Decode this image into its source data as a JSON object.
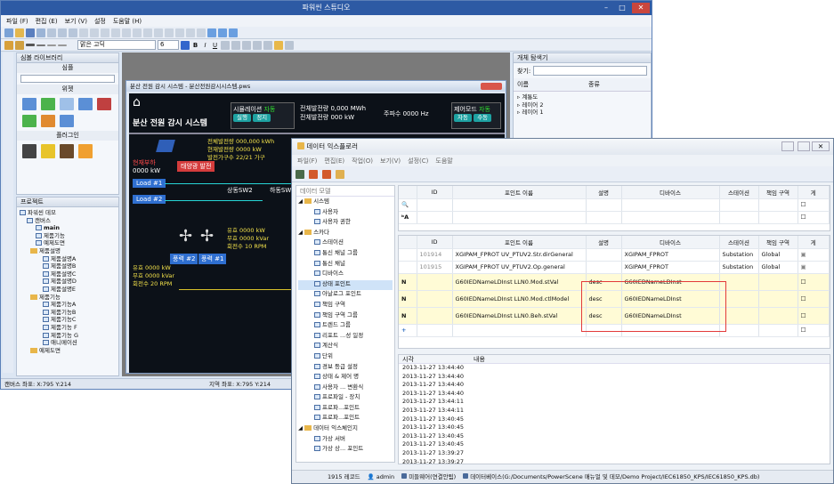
{
  "studio": {
    "title": "파워씬 스튜디오",
    "menu": [
      "파일 (F)",
      "편집 (E)",
      "보기 (V)",
      "설정",
      "도움말 (H)"
    ],
    "font_name": "맑은 고딕",
    "font_size": "6",
    "status_left": "캔버스 좌표: X:795 Y:214",
    "status_mid": "지역 좌표: X:795 Y:214"
  },
  "symbol_lib": {
    "title": "심볼 라이브러리",
    "sec1": "심플",
    "sec2": "위젯",
    "sec3": "플러그인"
  },
  "project": {
    "title": "프로젝트",
    "items": [
      "파워씬 데모",
      "캔버스",
      "main",
      "제품기능",
      "예제도면",
      "제품설명",
      "제품설명A",
      "제품설명B",
      "제품설명C",
      "제품설명D",
      "제품설명E",
      "제품기능",
      "제품기능A",
      "제품기능B",
      "제품기능C",
      "제품기능 F",
      "제품기능 G",
      "애니메이션",
      "예제도면"
    ]
  },
  "obj_explorer": {
    "title": "개체 탐색기",
    "search": "찾기:",
    "col_name": "이름",
    "col_type": "종류",
    "items": [
      "계통도",
      "레이어 2",
      "레이어 1"
    ]
  },
  "doc": {
    "title": "분산 전원 감시 시스템 - 분산전원감시시스템.pws",
    "heading": "분산 전원 감시 시스템",
    "sim_label": "시뮬레이션",
    "sim_state": "자동",
    "btn_run": "실행",
    "btn_stop": "정지",
    "total_gen": "전체발전량",
    "total_gen_val": "0,000 MWh",
    "total_pow": "전체발전량",
    "total_pow_val": "000 kW",
    "freq_label": "주파수",
    "freq_val": "0000 Hz",
    "ctrl_mode": "제어모드",
    "ctrl_state": "자동",
    "btn_auto": "자동",
    "btn_manual": "수동",
    "solar_lines": [
      "전체발전량 000,000 kWh",
      "현재발전량 0000 kW",
      "발전가구수 22/21 가구"
    ],
    "load_now": "현재부하",
    "load_val": "0000 kW",
    "solar_btn": "태양광 발전",
    "load1": "Load #1",
    "load2": "Load #2",
    "sw2": "상동SW2",
    "sw1": "하동SW1",
    "wind_lines": [
      "유효 0000 kW",
      "무효 0000 kVar",
      "회전수 10 RPM"
    ],
    "wind_btn1": "풍력 #2",
    "wind_btn2": "풍력 #1",
    "wind2_lines": [
      "유효 0000 kW",
      "무효 0000 kVar",
      "회전수 20 RPM"
    ]
  },
  "explorer": {
    "title": "데이터 익스플로러",
    "menu": [
      "파일(F)",
      "편집(E)",
      "작업(O)",
      "보기(V)",
      "설정(C)",
      "도움말"
    ],
    "model_hdr": "데이터 모델",
    "tree": [
      "시스템",
      "사용자",
      "사용자 권한",
      "스카다",
      "스테이션",
      "통신 채널 그룹",
      "통신 채널",
      "디바이스",
      "상태 포인트",
      "아날로그 포인트",
      "책임 구역",
      "책임 구역 그룹",
      "트렌드 그룹",
      "리포트 ...성 일정",
      "계산식",
      "단위",
      "경보 등급 설정",
      "상태 & 제어 명",
      "사용자 ... 변환식",
      "프로파일 - 장치",
      "프로파...포인트",
      "프로파...포인트",
      "데이터 익스체인지",
      "가상 서버",
      "가상 상... 포인트"
    ],
    "cols": [
      "ID",
      "포인트 이름",
      "설명",
      "디바이스",
      "스테이션",
      "책임 구역",
      "게"
    ],
    "rows": [
      {
        "mark": "",
        "id": "101914",
        "name": "XGIPAM_FPROT UV_PTUV2.Str.dirGeneral",
        "desc": "",
        "dev": "XGIPAM_FPROT",
        "st": "Substation",
        "area": "Global"
      },
      {
        "mark": "",
        "id": "101915",
        "name": "XGIPAM_FPROT UV_PTUV2.Op.general",
        "desc": "",
        "dev": "XGIPAM_FPROT",
        "st": "Substation",
        "area": "Global"
      },
      {
        "mark": "N",
        "id": "",
        "name": "G60IEDNameLDInst LLN0.Mod.stVal",
        "desc": "desc",
        "dev": "G60IEDNameLDInst",
        "st": "",
        "area": ""
      },
      {
        "mark": "N",
        "id": "",
        "name": "G60IEDNameLDInst LLN0.Mod.ctlModel",
        "desc": "desc",
        "dev": "G60IEDNameLDInst",
        "st": "",
        "area": ""
      },
      {
        "mark": "N",
        "id": "",
        "name": "G60IEDNameLDInst LLN0.Beh.stVal",
        "desc": "desc",
        "dev": "G60IEDNameLDInst",
        "st": "",
        "area": ""
      }
    ],
    "log_cols": [
      "시각",
      "내용"
    ],
    "log": [
      "2013-11-27 13:44:40",
      "2013-11-27 13:44:40",
      "2013-11-27 13:44:40",
      "2013-11-27 13:44:40",
      "2013-11-27 13:44:11",
      "2013-11-27 13:44:11",
      "2013-11-27 13:40:45",
      "2013-11-27 13:40:45",
      "2013-11-27 13:40:45",
      "2013-11-27 13:40:45",
      "2013-11-27 13:39:27",
      "2013-11-27 13:39:27"
    ],
    "status_records": "1915 레코드",
    "status_user": "admin",
    "status_mw": "미들웨어(연결안됨)",
    "status_db": "데이터베이스(G:/Documents/PowerScene 매뉴얼 및 데모/Demo Project/IEC61850_KPS/IEC61850_KPS.db)"
  }
}
